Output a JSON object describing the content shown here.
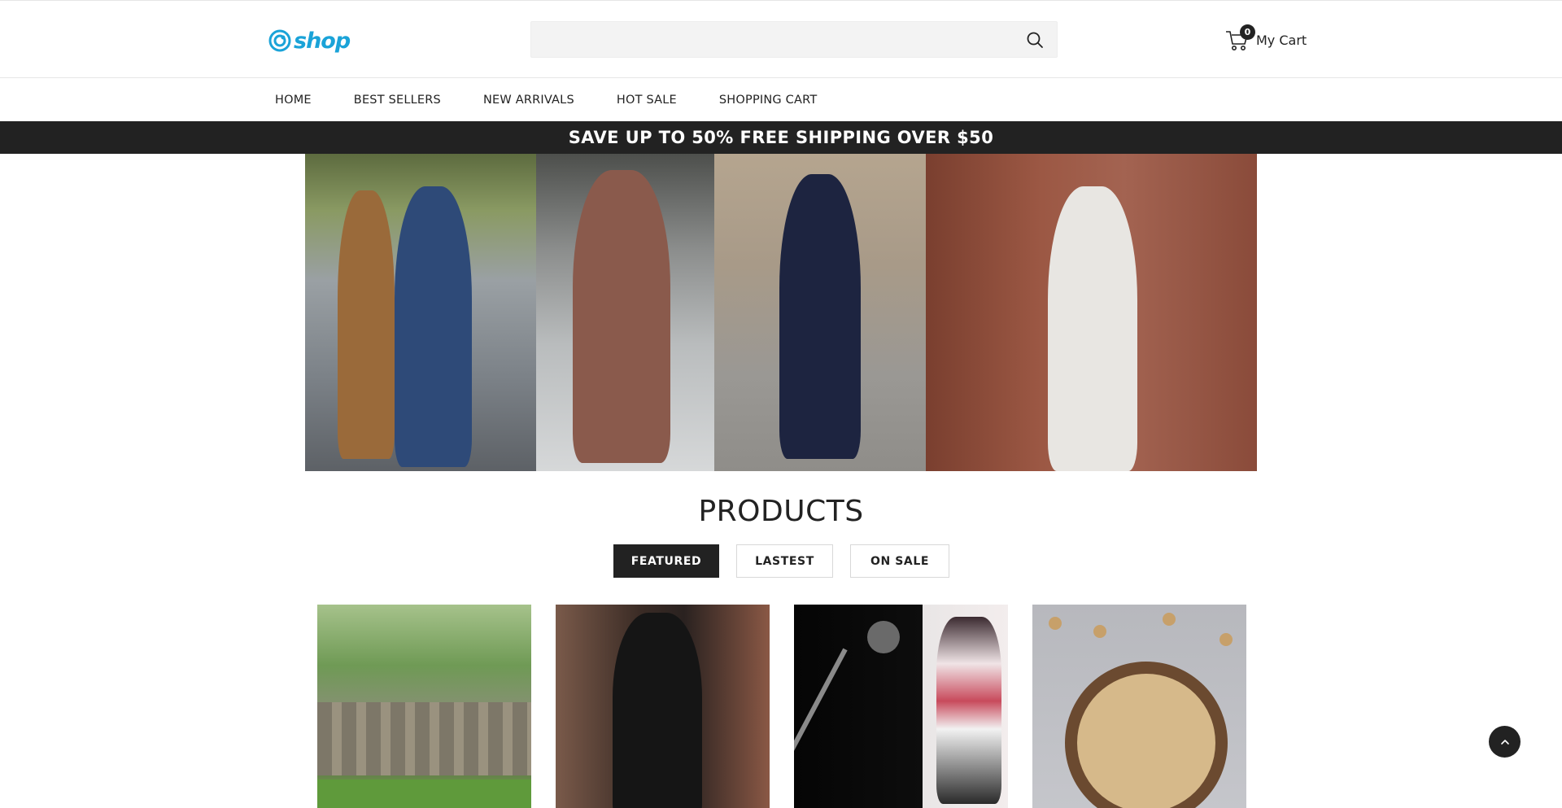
{
  "header": {
    "logo_text": "shop",
    "search": {
      "value": "",
      "placeholder": ""
    },
    "cart": {
      "count": "0",
      "label": "My Cart"
    }
  },
  "nav": {
    "items": [
      {
        "label": "HOME"
      },
      {
        "label": "BEST SELLERS"
      },
      {
        "label": "NEW ARRIVALS"
      },
      {
        "label": "HOT SALE"
      },
      {
        "label": "SHOPPING CART"
      }
    ]
  },
  "promo": {
    "text": "SAVE UP TO 50% FREE SHIPPING OVER $50"
  },
  "products": {
    "title": "PRODUCTS",
    "tabs": [
      {
        "label": "FEATURED",
        "active": true
      },
      {
        "label": "LASTEST",
        "active": false
      },
      {
        "label": "ON SALE",
        "active": false
      }
    ]
  },
  "colors": {
    "brand": "#1aa3d8",
    "dark": "#222222",
    "search_bg": "#f3f3f3"
  },
  "icons": [
    "logo-swirl-icon",
    "search-icon",
    "cart-icon",
    "chevron-up-icon"
  ]
}
